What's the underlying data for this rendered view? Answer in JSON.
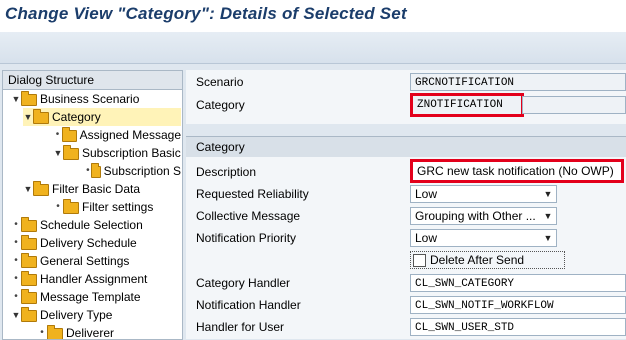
{
  "window": {
    "title": "Change View \"Category\": Details of Selected Set"
  },
  "tree": {
    "header": "Dialog Structure",
    "items": [
      {
        "label": "Business Scenario",
        "level": 0,
        "marker": "▼",
        "selected": false
      },
      {
        "label": "Category",
        "level": 1,
        "marker": "▼",
        "selected": true
      },
      {
        "label": "Assigned Message",
        "level": 2,
        "marker": "•",
        "selected": false
      },
      {
        "label": "Subscription Basic",
        "level": 2,
        "marker": "▼",
        "selected": false
      },
      {
        "label": "Subscription S",
        "level": 3,
        "marker": "•",
        "selected": false
      },
      {
        "label": "Filter Basic Data",
        "level": 1,
        "marker": "▼",
        "selected": false
      },
      {
        "label": "Filter settings",
        "level": 2,
        "marker": "•",
        "selected": false
      },
      {
        "label": "Schedule Selection",
        "level": 0,
        "marker": "•",
        "selected": false
      },
      {
        "label": "Delivery Schedule",
        "level": 0,
        "marker": "•",
        "selected": false
      },
      {
        "label": "General Settings",
        "level": 0,
        "marker": "•",
        "selected": false
      },
      {
        "label": "Handler Assignment",
        "level": 0,
        "marker": "•",
        "selected": false
      },
      {
        "label": "Message Template",
        "level": 0,
        "marker": "•",
        "selected": false
      },
      {
        "label": "Delivery Type",
        "level": 0,
        "marker": "▼",
        "selected": false
      },
      {
        "label": "Deliverer",
        "level": 1,
        "marker": "•",
        "selected": false
      }
    ]
  },
  "header_fields": {
    "scenario": {
      "label": "Scenario",
      "value": "GRCNOTIFICATION"
    },
    "category": {
      "label": "Category",
      "value": "ZNOTIFICATION"
    }
  },
  "category_group": {
    "title": "Category",
    "description": {
      "label": "Description",
      "value": "GRC new task notification (No OWP)"
    },
    "requested_reliability": {
      "label": "Requested Reliability",
      "value": "Low"
    },
    "collective_message": {
      "label": "Collective Message",
      "value": "Grouping with Other ..."
    },
    "notification_priority": {
      "label": "Notification Priority",
      "value": "Low"
    },
    "delete_after_send": {
      "label": "Delete After Send",
      "checked": false
    },
    "category_handler": {
      "label": "Category Handler",
      "value": "CL_SWN_CATEGORY"
    },
    "notification_handler": {
      "label": "Notification Handler",
      "value": "CL_SWN_NOTIF_WORKFLOW"
    },
    "handler_for_user": {
      "label": "Handler for User",
      "value": "CL_SWN_USER_STD"
    }
  },
  "colors": {
    "title": "#1b3d6b",
    "highlight": "#e3001b",
    "selected_row": "#fff3b8",
    "folder": "#f0b21e"
  }
}
